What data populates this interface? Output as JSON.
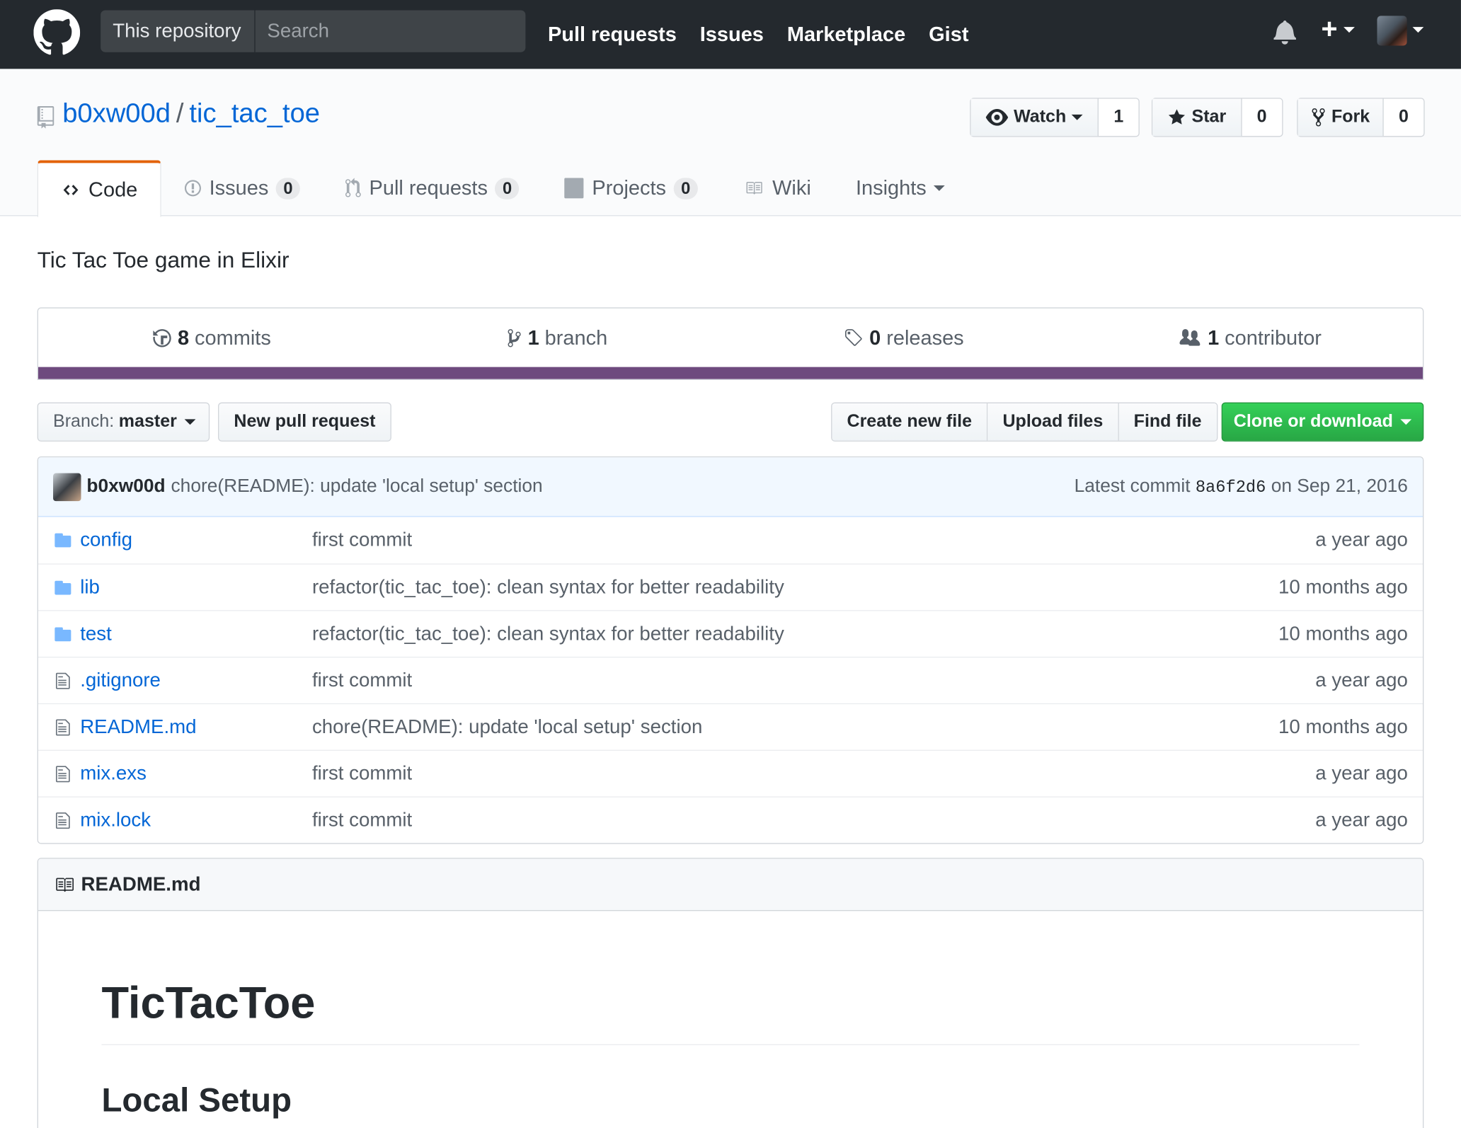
{
  "header": {
    "scope_label": "This repository",
    "search_placeholder": "Search",
    "nav": [
      "Pull requests",
      "Issues",
      "Marketplace",
      "Gist"
    ]
  },
  "repo": {
    "owner": "b0xw00d",
    "separator": "/",
    "name": "tic_tac_toe",
    "watch_label": "Watch",
    "watch_count": "1",
    "star_label": "Star",
    "star_count": "0",
    "fork_label": "Fork",
    "fork_count": "0"
  },
  "tabs": [
    {
      "label": "Code",
      "count": null,
      "active": true
    },
    {
      "label": "Issues",
      "count": "0"
    },
    {
      "label": "Pull requests",
      "count": "0"
    },
    {
      "label": "Projects",
      "count": "0"
    },
    {
      "label": "Wiki",
      "count": null
    },
    {
      "label": "Insights",
      "count": null
    }
  ],
  "description": "Tic Tac Toe game in Elixir",
  "stats": [
    {
      "num": "8",
      "label": "commits"
    },
    {
      "num": "1",
      "label": "branch"
    },
    {
      "num": "0",
      "label": "releases"
    },
    {
      "num": "1",
      "label": "contributor"
    }
  ],
  "language_bar_color": "#6e4a7e",
  "filenav": {
    "branch_prefix": "Branch:",
    "branch": "master",
    "new_pr": "New pull request",
    "create_file": "Create new file",
    "upload_files": "Upload files",
    "find_file": "Find file",
    "clone": "Clone or download"
  },
  "latest_commit": {
    "author": "b0xw00d",
    "message": "chore(README): update 'local setup' section",
    "prefix": "Latest commit",
    "sha": "8a6f2d6",
    "date": "on Sep 21, 2016"
  },
  "files": [
    {
      "type": "dir",
      "name": "config",
      "message": "first commit",
      "age": "a year ago"
    },
    {
      "type": "dir",
      "name": "lib",
      "message": "refactor(tic_tac_toe): clean syntax for better readability",
      "age": "10 months ago"
    },
    {
      "type": "dir",
      "name": "test",
      "message": "refactor(tic_tac_toe): clean syntax for better readability",
      "age": "10 months ago"
    },
    {
      "type": "file",
      "name": ".gitignore",
      "message": "first commit",
      "age": "a year ago"
    },
    {
      "type": "file",
      "name": "README.md",
      "message": "chore(README): update 'local setup' section",
      "age": "10 months ago"
    },
    {
      "type": "file",
      "name": "mix.exs",
      "message": "first commit",
      "age": "a year ago"
    },
    {
      "type": "file",
      "name": "mix.lock",
      "message": "first commit",
      "age": "a year ago"
    }
  ],
  "readme": {
    "title": "README.md",
    "h1": "TicTacToe",
    "h2": "Local Setup"
  },
  "colors": {
    "header_bg": "#24292e",
    "link": "#0366d6",
    "active_tab_accent": "#e36209",
    "clone_green": "#28a745"
  }
}
